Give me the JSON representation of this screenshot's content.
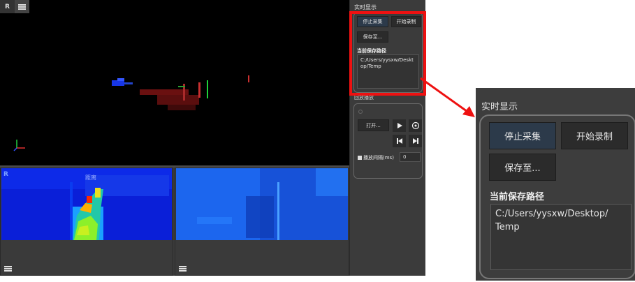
{
  "view3d": {
    "badge": "R"
  },
  "depth_view": {
    "badge": "R",
    "distance_label": "距离"
  },
  "side_panel": {
    "realtime": {
      "title": "实时显示",
      "stop_capture": "停止采集",
      "start_record": "开始录制",
      "save_to": "保存至...",
      "save_path_label": "当前保存路径",
      "save_path_value": "C:/Users/yysxw/Desktop/Temp"
    },
    "playback": {
      "title": "回放播放",
      "open_button": "打开...",
      "interval_label": "播放间隔(ms)",
      "interval_value": "0"
    }
  },
  "zoom": {
    "title": "实时显示",
    "stop_capture": "停止采集",
    "start_record": "开始录制",
    "save_to": "保存至...",
    "save_path_label": "当前保存路径",
    "save_path_line1": "C:/Users/yysxw/Desktop/",
    "save_path_line2": "Temp"
  },
  "colors": {
    "highlight": "#ee1111",
    "panel_bg": "#3b3b3b",
    "button_bg": "#2b2b2b"
  }
}
